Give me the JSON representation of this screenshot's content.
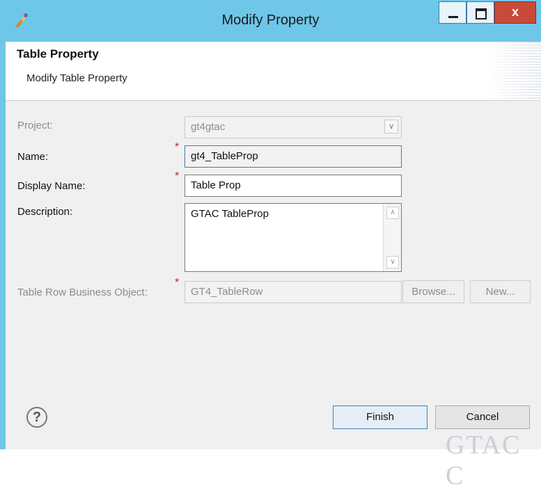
{
  "window": {
    "title": "Modify Property",
    "close_glyph": "x"
  },
  "banner": {
    "title": "Table Property",
    "subtitle": "Modify Table Property"
  },
  "form": {
    "project": {
      "label": "Project:",
      "value": "gt4gtac"
    },
    "name": {
      "label": "Name:",
      "value": "gt4_TableProp"
    },
    "display_name": {
      "label": "Display Name:",
      "value": "Table Prop"
    },
    "description": {
      "label": "Description:",
      "value": "GTAC TableProp"
    },
    "table_row_bo": {
      "label": "Table Row Business Object:",
      "value": "GT4_TableRow"
    },
    "required_marker": "*"
  },
  "buttons": {
    "browse": "Browse...",
    "new": "New...",
    "finish": "Finish",
    "cancel": "Cancel",
    "help": "?"
  },
  "watermark": "GTAC C",
  "colors": {
    "titlebar": "#6ec6e9",
    "required": "#b8292e",
    "close": "#c94a3a"
  }
}
